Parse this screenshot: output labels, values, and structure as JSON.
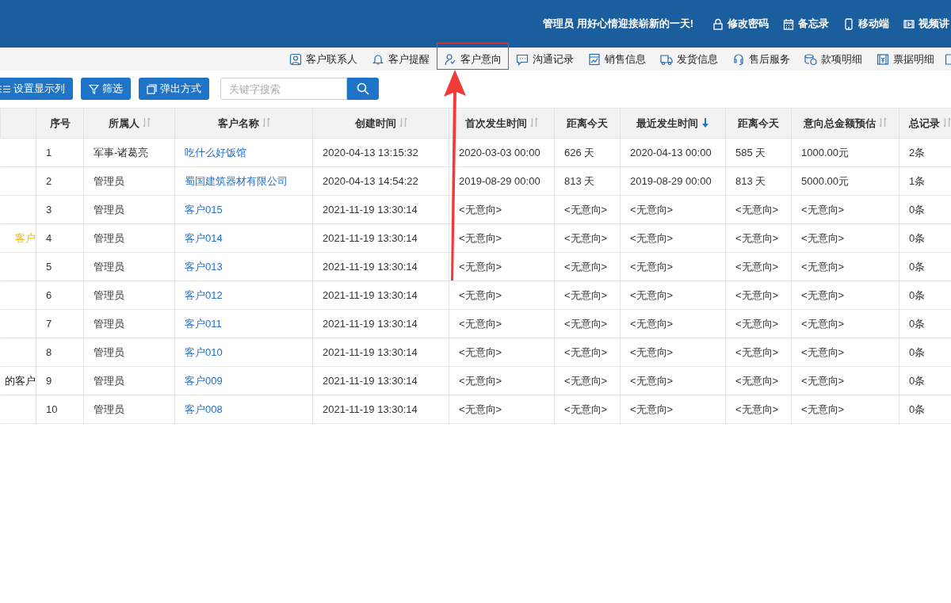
{
  "header": {
    "greeting": "管理员 用好心情迎接崭新的一天!",
    "links": [
      {
        "label": "修改密码"
      },
      {
        "label": "备忘录"
      },
      {
        "label": "移动端"
      },
      {
        "label": "视频讲"
      }
    ]
  },
  "toolbar": {
    "items": [
      {
        "label": "客户联系人",
        "highlighted": false
      },
      {
        "label": "客户提醒",
        "highlighted": false
      },
      {
        "label": "客户意向",
        "highlighted": true
      },
      {
        "label": "沟通记录",
        "highlighted": false
      },
      {
        "label": "销售信息",
        "highlighted": false
      },
      {
        "label": "发货信息",
        "highlighted": false
      },
      {
        "label": "售后服务",
        "highlighted": false
      },
      {
        "label": "款项明细",
        "highlighted": false
      },
      {
        "label": "票据明细",
        "highlighted": false
      }
    ]
  },
  "actions": [
    {
      "label": "设置显示列"
    },
    {
      "label": "筛选"
    },
    {
      "label": "弹出方式"
    }
  ],
  "search": {
    "placeholder": "关键字搜索"
  },
  "table": {
    "columns": [
      {
        "sortable": false,
        "sorted": false
      },
      {
        "label": "序号",
        "sortable": false,
        "sorted": false
      },
      {
        "label": "所属人",
        "sortable": true,
        "sorted": false
      },
      {
        "label": "客户名称",
        "sortable": true,
        "sorted": false
      },
      {
        "label": "创建时间",
        "sortable": true,
        "sorted": false
      },
      {
        "label": "首次发生时间",
        "sortable": true,
        "sorted": false
      },
      {
        "label": "距离今天",
        "sortable": false,
        "sorted": false
      },
      {
        "label": "最近发生时间",
        "sorted": true
      },
      {
        "label": "距离今天",
        "sortable": false,
        "sorted": false
      },
      {
        "label": "意向总金额预估",
        "sortable": true,
        "sorted": false
      },
      {
        "label": "总记录",
        "sortable": true,
        "sorted": false
      }
    ],
    "rows": [
      {
        "cells": [
          "",
          "1",
          "军事-诸葛亮",
          "吃什么好饭馆",
          "2020-04-13 13:15:32",
          "2020-03-03 00:00",
          "626 天",
          "2020-04-13 00:00",
          "585 天",
          "1000.00元",
          "2条"
        ]
      },
      {
        "cells": [
          "",
          "2",
          "管理员",
          "蜀国建筑器材有限公司",
          "2020-04-13 14:54:22",
          "2019-08-29 00:00",
          "813 天",
          "2019-08-29 00:00",
          "813 天",
          "5000.00元",
          "1条"
        ]
      },
      {
        "cells": [
          "",
          "3",
          "管理员",
          "客户015",
          "2021-11-19 13:30:14",
          "<无意向>",
          "<无意向>",
          "<无意向>",
          "<无意向>",
          "<无意向>",
          "0条"
        ]
      },
      {
        "label_highlighted": true,
        "cells": [
          "客户",
          "4",
          "管理员",
          "客户014",
          "2021-11-19 13:30:14",
          "<无意向>",
          "<无意向>",
          "<无意向>",
          "<无意向>",
          "<无意向>",
          "0条"
        ]
      },
      {
        "cells": [
          "",
          "5",
          "管理员",
          "客户013",
          "2021-11-19 13:30:14",
          "<无意向>",
          "<无意向>",
          "<无意向>",
          "<无意向>",
          "<无意向>",
          "0条"
        ]
      },
      {
        "cells": [
          "",
          "6",
          "管理员",
          "客户012",
          "2021-11-19 13:30:14",
          "<无意向>",
          "<无意向>",
          "<无意向>",
          "<无意向>",
          "<无意向>",
          "0条"
        ]
      },
      {
        "cells": [
          "",
          "7",
          "管理员",
          "客户011",
          "2021-11-19 13:30:14",
          "<无意向>",
          "<无意向>",
          "<无意向>",
          "<无意向>",
          "<无意向>",
          "0条"
        ]
      },
      {
        "cells": [
          "",
          "8",
          "管理员",
          "客户010",
          "2021-11-19 13:30:14",
          "<无意向>",
          "<无意向>",
          "<无意向>",
          "<无意向>",
          "<无意向>",
          "0条"
        ]
      },
      {
        "label_highlighted": false,
        "cells": [
          "的客户",
          "9",
          "管理员",
          "客户009",
          "2021-11-19 13:30:14",
          "<无意向>",
          "<无意向>",
          "<无意向>",
          "<无意向>",
          "<无意向>",
          "0条"
        ]
      },
      {
        "cells": [
          "",
          "10",
          "管理员",
          "客户008",
          "2021-11-19 13:30:14",
          "<无意向>",
          "<无意向>",
          "<无意向>",
          "<无意向>",
          "<无意向>",
          "0条"
        ]
      }
    ]
  }
}
